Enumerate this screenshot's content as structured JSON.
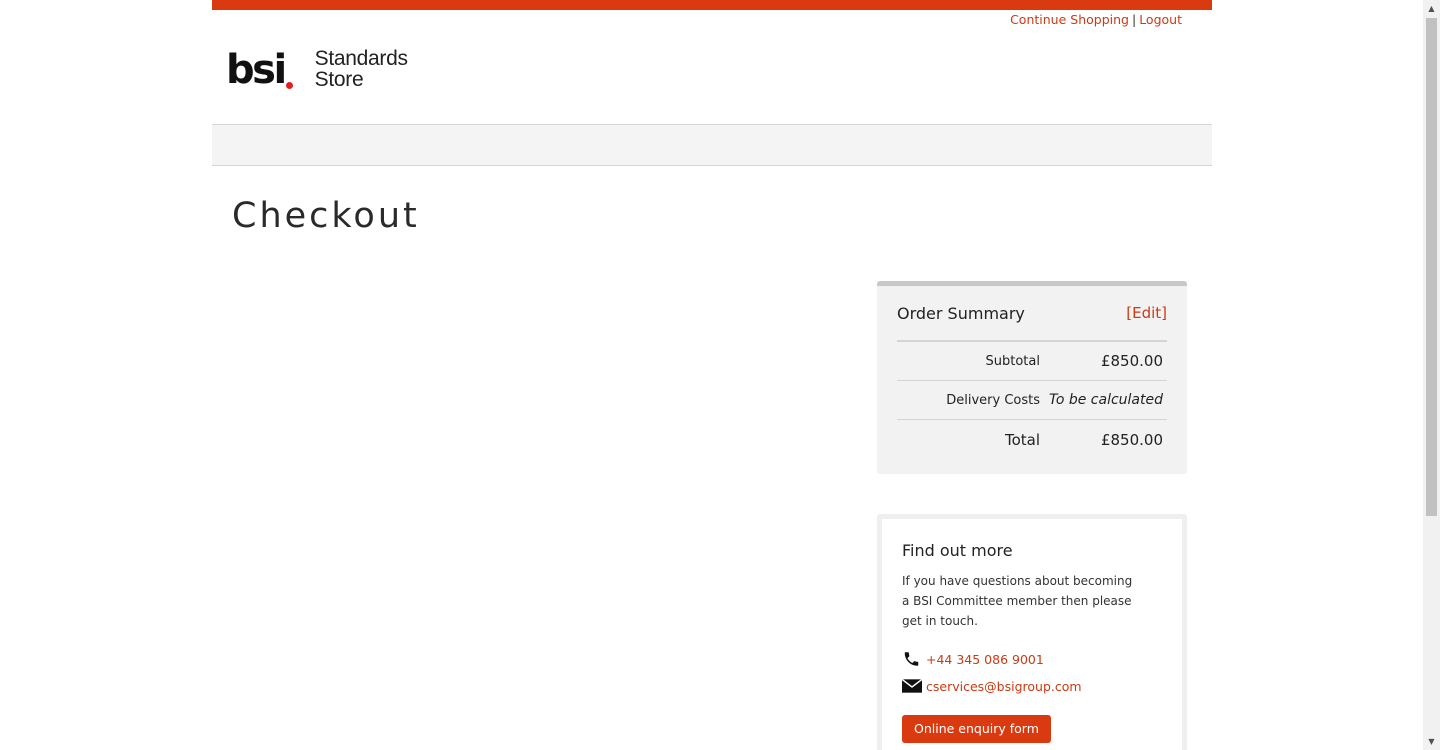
{
  "header": {
    "continue_shopping": "Continue Shopping",
    "separator": "|",
    "logout": "Logout",
    "logo_mark": "bsi",
    "logo_line1": "Standards",
    "logo_line2": "Store",
    "accent_color": "#d93a0f"
  },
  "main": {
    "page_title": "Checkout"
  },
  "order_summary": {
    "title": "Order Summary",
    "edit_label": "[Edit]",
    "rows": [
      {
        "label": "Subtotal",
        "value": "£850.00"
      },
      {
        "label": "Delivery Costs",
        "value": "To be calculated"
      },
      {
        "label": "Total",
        "value": "£850.00"
      }
    ]
  },
  "find_out_more": {
    "title": "Find out more",
    "text": "If you have questions about becoming a BSI Committee member then please get in touch.",
    "phone": "+44 345 086 9001",
    "email": "cservices@bsigroup.com",
    "button_label": "Online enquiry form",
    "phone_icon": "phone-icon",
    "email_icon": "envelope-icon"
  }
}
